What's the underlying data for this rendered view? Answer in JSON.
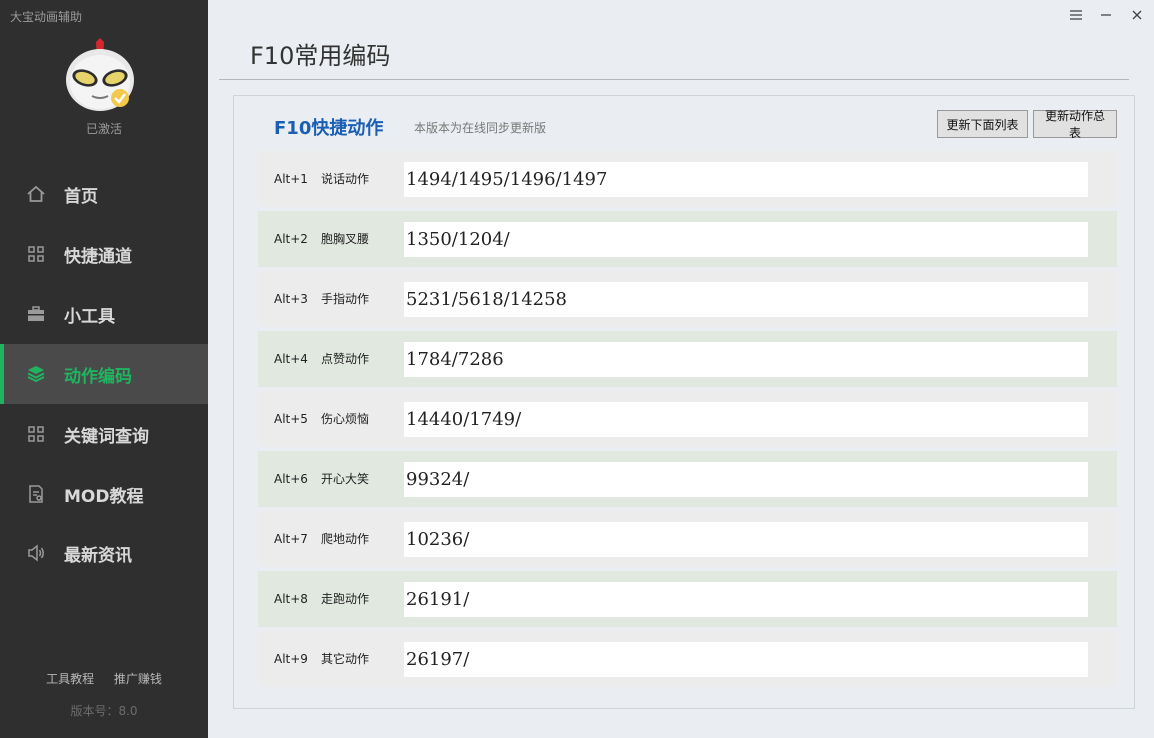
{
  "app": {
    "title": "大宝动画辅助",
    "activated": "已激活"
  },
  "sidebar": {
    "items": [
      {
        "label": "首页",
        "icon": "home-icon"
      },
      {
        "label": "快捷通道",
        "icon": "grid-icon"
      },
      {
        "label": "小工具",
        "icon": "toolbox-icon"
      },
      {
        "label": "动作编码",
        "icon": "layers-icon",
        "active": true
      },
      {
        "label": "关键词查询",
        "icon": "grid-icon"
      },
      {
        "label": "MOD教程",
        "icon": "document-icon"
      },
      {
        "label": "最新资讯",
        "icon": "speaker-icon"
      }
    ],
    "footer": {
      "tutorial": "工具教程",
      "promote": "推广赚钱",
      "version": "版本号：8.0"
    }
  },
  "colors": {
    "sidebar_bg": "#2f2f2f",
    "accent_green": "#1fb560",
    "title_blue": "#1a5fb4"
  },
  "main": {
    "page_title": "F10常用编码",
    "section_title": "F10快捷动作",
    "section_note": "本版本为在线同步更新版",
    "buttons": {
      "update_list": "更新下面列表",
      "update_summary": "更新动作总表"
    },
    "rows": [
      {
        "key": "Alt+1",
        "name": "说话动作",
        "value": "1494/1495/1496/1497"
      },
      {
        "key": "Alt+2",
        "name": "胞胸叉腰",
        "value": "1350/1204/"
      },
      {
        "key": "Alt+3",
        "name": "手指动作",
        "value": "5231/5618/14258"
      },
      {
        "key": "Alt+4",
        "name": "点赞动作",
        "value": "1784/7286"
      },
      {
        "key": "Alt+5",
        "name": "伤心烦恼",
        "value": "14440/1749/"
      },
      {
        "key": "Alt+6",
        "name": "开心大笑",
        "value": "99324/"
      },
      {
        "key": "Alt+7",
        "name": "爬地动作",
        "value": "10236/"
      },
      {
        "key": "Alt+8",
        "name": "走跑动作",
        "value": "26191/"
      },
      {
        "key": "Alt+9",
        "name": "其它动作",
        "value": "26197/"
      }
    ]
  }
}
